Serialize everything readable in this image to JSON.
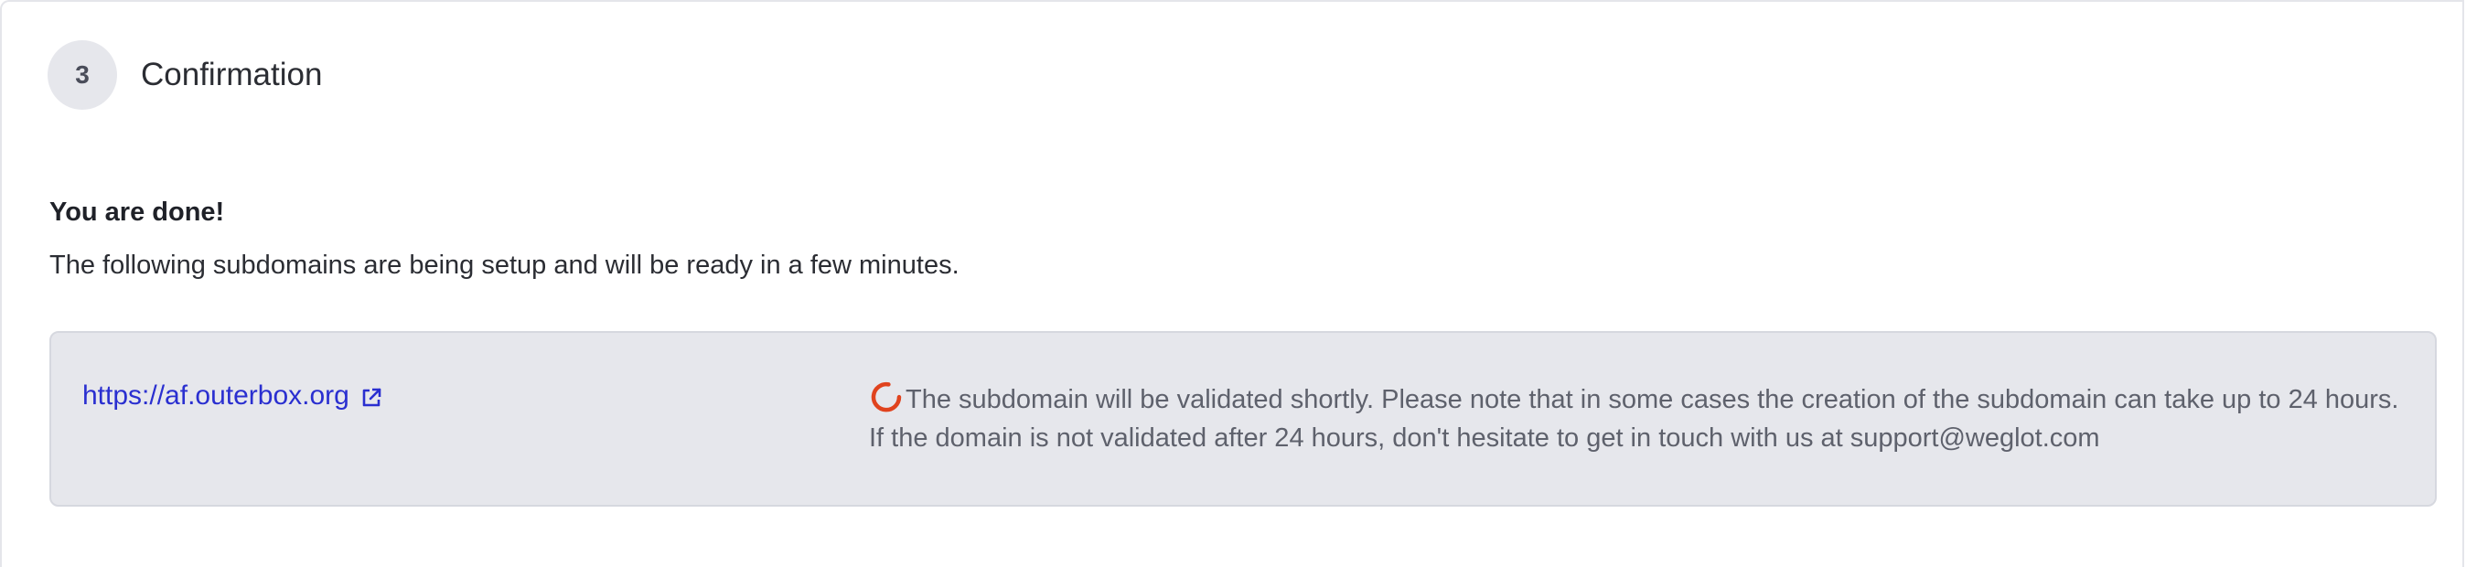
{
  "step": {
    "number": "3",
    "title": "Confirmation"
  },
  "result": {
    "heading": "You are done!",
    "description": "The following subdomains are being setup and will be ready in a few minutes."
  },
  "subdomains": [
    {
      "url": "https://af.outerbox.org",
      "status_text": "The subdomain will be validated shortly. Please note that in some cases the creation of the subdomain can take up to 24 hours. If the domain is not validated after 24 hours, don't hesitate to get in touch with us at support@weglot.com",
      "status_icon": "loading-spinner-icon"
    }
  ],
  "colors": {
    "link": "#2a2fd0",
    "spinner": "#e0431e",
    "card_bg": "#e6e7ec"
  }
}
